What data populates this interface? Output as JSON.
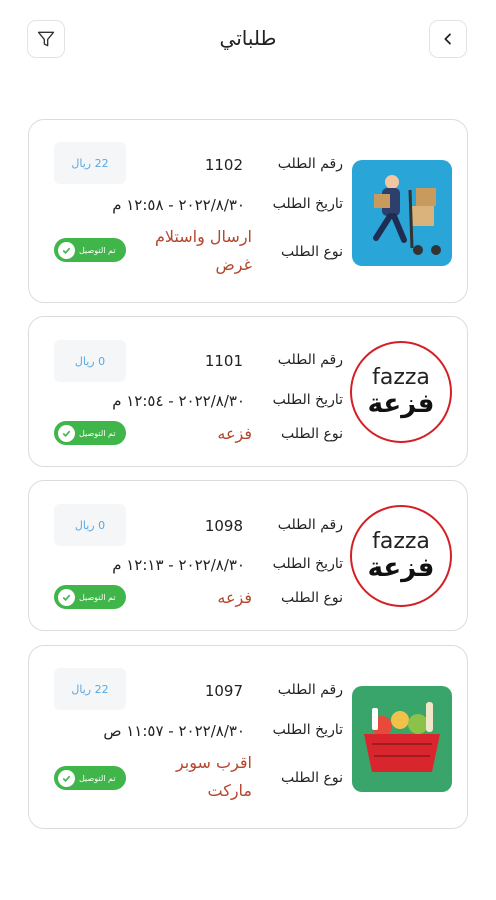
{
  "header": {
    "title": "طلباتي",
    "filter_icon": "filter-icon",
    "back_icon": "chevron-left-icon"
  },
  "labels": {
    "order_number": "رقم الطلب",
    "order_date": "تاريخ الطلب",
    "order_type": "نوع الطلب"
  },
  "orders": [
    {
      "number": "1102",
      "date": "٢٠٢٢/٨/٣٠ - ١٢:٥٨ م",
      "type": "ارسال واستلام غرض",
      "price": "22 ريال",
      "status": "تم التوصيل",
      "image": "delivery-man-image"
    },
    {
      "number": "1101",
      "date": "٢٠٢٢/٨/٣٠ - ١٢:٥٤ م",
      "type": "فزعه",
      "price": "0 ريال",
      "status": "تم التوصيل",
      "image": "fazza-logo"
    },
    {
      "number": "1098",
      "date": "٢٠٢٢/٨/٣٠ - ١٢:١٣ م",
      "type": "فزعه",
      "price": "0 ريال",
      "status": "تم التوصيل",
      "image": "fazza-logo"
    },
    {
      "number": "1097",
      "date": "٢٠٢٢/٨/٣٠ - ١١:٥٧ ص",
      "type": "اقرب سوبر ماركت",
      "price": "22 ريال",
      "status": "تم التوصيل",
      "image": "grocery-basket-image"
    }
  ],
  "fazza_logo": {
    "latin": "fazza",
    "arabic": "فزعة"
  },
  "colors": {
    "accent_green": "#3fb54a",
    "type_red": "#b4472d",
    "price_blue": "#5aa8e0",
    "logo_red": "#d32027"
  }
}
